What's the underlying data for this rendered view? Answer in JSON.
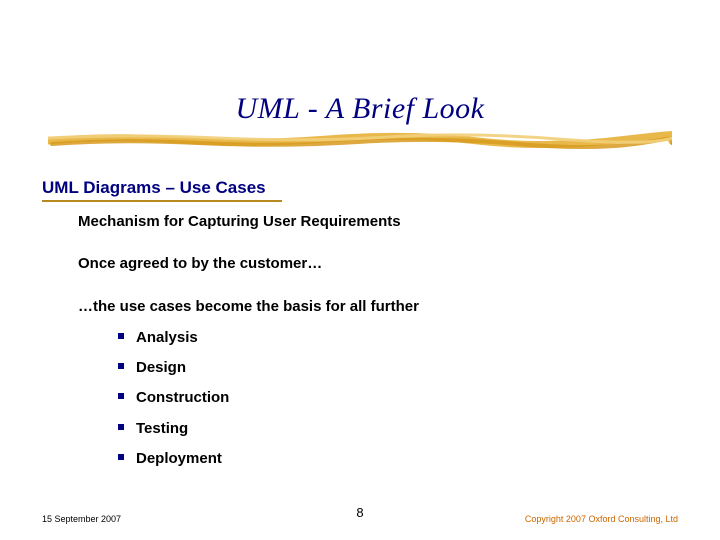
{
  "title": "UML - A Brief Look",
  "section_heading": "UML Diagrams – Use Cases",
  "para1": "Mechanism for Capturing User Requirements",
  "para2": "Once agreed to by the customer…",
  "para3": "…the use cases become the basis for all further",
  "bullets": [
    "Analysis",
    "Design",
    "Construction",
    "Testing",
    "Deployment"
  ],
  "footer": {
    "date": "15 September 2007",
    "page": "8",
    "copyright": "Copyright 2007 Oxford Consulting, Ltd"
  }
}
